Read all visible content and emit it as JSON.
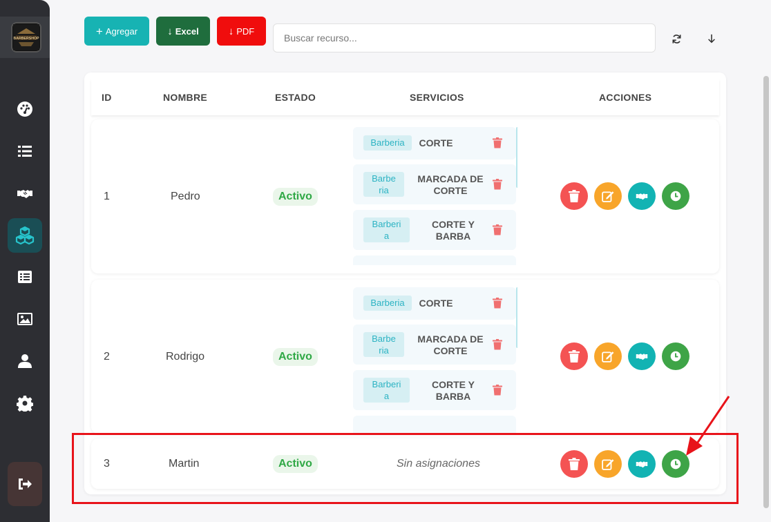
{
  "sidebar": {
    "logo_text": "BARBERSHOP",
    "items": [
      {
        "icon": "dashboard-icon"
      },
      {
        "icon": "list-icon"
      },
      {
        "icon": "handshake-icon"
      },
      {
        "icon": "cubes-icon",
        "active": true
      },
      {
        "icon": "list-alt-icon"
      },
      {
        "icon": "image-icon"
      },
      {
        "icon": "user-icon"
      },
      {
        "icon": "gear-icon"
      }
    ],
    "logout_icon": "logout-icon"
  },
  "toolbar": {
    "add_label": "Agregar",
    "excel_label": "Excel",
    "pdf_label": "PDF",
    "search_placeholder": "Buscar recurso..."
  },
  "table": {
    "headers": {
      "id": "ID",
      "nombre": "NOMBRE",
      "estado": "ESTADO",
      "servicios": "SERVICIOS",
      "acciones": "ACCIONES"
    },
    "rows": [
      {
        "id": "1",
        "nombre": "Pedro",
        "estado": "Activo",
        "servicios": [
          {
            "cat_lines": [
              "Barberia"
            ],
            "name_lines": [
              "CORTE"
            ]
          },
          {
            "cat_lines": [
              "Barbe",
              "ria"
            ],
            "name_lines": [
              "MARCADA DE",
              "CORTE"
            ]
          },
          {
            "cat_lines": [
              "Barberi",
              "a"
            ],
            "name_lines": [
              "CORTE Y",
              "BARBA"
            ]
          }
        ]
      },
      {
        "id": "2",
        "nombre": "Rodrigo",
        "estado": "Activo",
        "servicios": [
          {
            "cat_lines": [
              "Barberia"
            ],
            "name_lines": [
              "CORTE"
            ]
          },
          {
            "cat_lines": [
              "Barbe",
              "ria"
            ],
            "name_lines": [
              "MARCADA DE",
              "CORTE"
            ]
          },
          {
            "cat_lines": [
              "Barberi",
              "a"
            ],
            "name_lines": [
              "CORTE Y",
              "BARBA"
            ]
          }
        ]
      },
      {
        "id": "3",
        "nombre": "Martin",
        "estado": "Activo",
        "sin_asignaciones": "Sin asignaciones"
      }
    ]
  },
  "colors": {
    "sidebar": "#2d2e33",
    "teal": "#17b3b3",
    "excel": "#1f6d3d",
    "pdf": "#f00d0d",
    "delete": "#f45353",
    "edit": "#f8a52a",
    "assign": "#12b3b3",
    "schedule": "#3ea447",
    "highlight": "#e8131a"
  }
}
